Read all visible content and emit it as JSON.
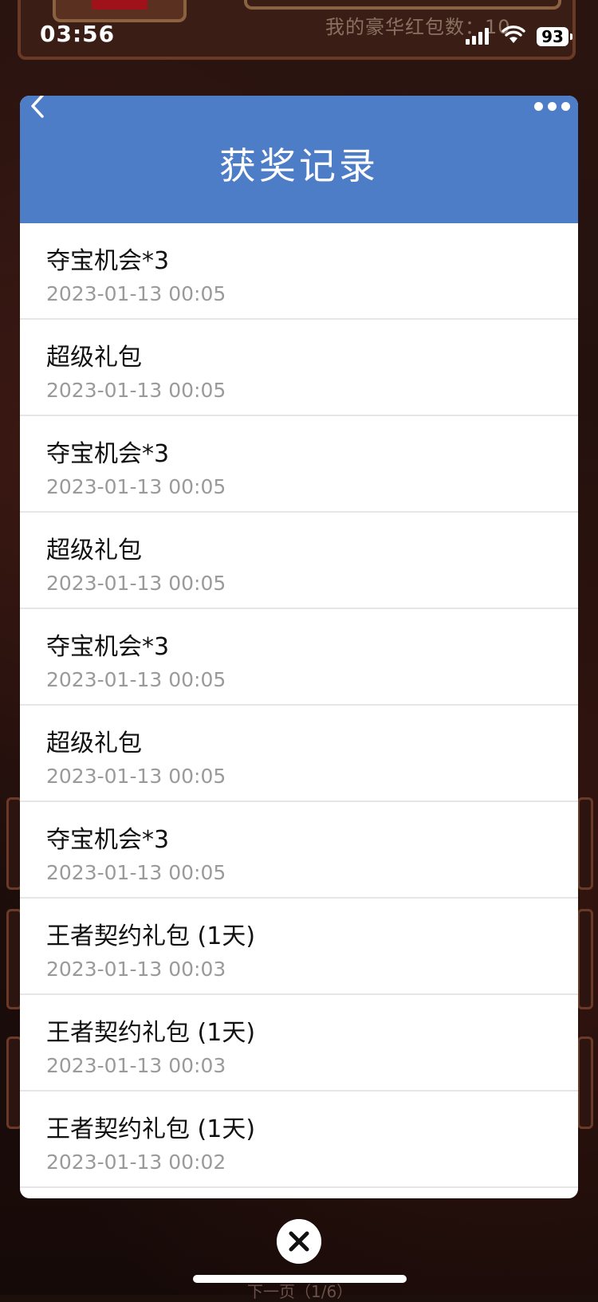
{
  "status_bar": {
    "time": "03:56",
    "battery": "93"
  },
  "background": {
    "red_packet_count": "我的豪华红包数：10",
    "next_page": "下一页（1/6）"
  },
  "panel": {
    "title": "获奖记录",
    "records": [
      {
        "prize": "夺宝机会*3",
        "date": "2023-01-13 00:05"
      },
      {
        "prize": "超级礼包",
        "date": "2023-01-13 00:05"
      },
      {
        "prize": "夺宝机会*3",
        "date": "2023-01-13 00:05"
      },
      {
        "prize": "超级礼包",
        "date": "2023-01-13 00:05"
      },
      {
        "prize": "夺宝机会*3",
        "date": "2023-01-13 00:05"
      },
      {
        "prize": "超级礼包",
        "date": "2023-01-13 00:05"
      },
      {
        "prize": "夺宝机会*3",
        "date": "2023-01-13 00:05"
      },
      {
        "prize": "王者契约礼包 (1天)",
        "date": "2023-01-13 00:03"
      },
      {
        "prize": "王者契约礼包 (1天)",
        "date": "2023-01-13 00:03"
      },
      {
        "prize": "王者契约礼包 (1天)",
        "date": "2023-01-13 00:02"
      }
    ]
  },
  "colors": {
    "header": "#4e7dc7",
    "background": "#1d0f0c"
  },
  "icons": {
    "back": "chevron-left-icon",
    "more": "more-dots-icon",
    "close": "close-icon"
  }
}
